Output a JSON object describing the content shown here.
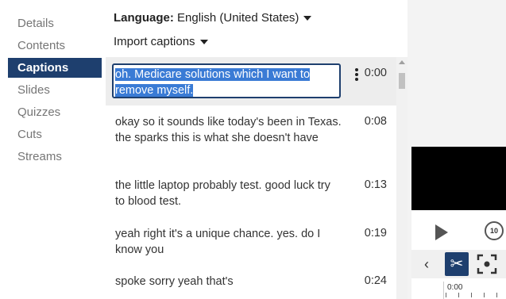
{
  "nav": {
    "items": [
      {
        "label": "Details",
        "active": false
      },
      {
        "label": "Contents",
        "active": false
      },
      {
        "label": "Captions",
        "active": true
      },
      {
        "label": "Slides",
        "active": false
      },
      {
        "label": "Quizzes",
        "active": false
      },
      {
        "label": "Cuts",
        "active": false
      },
      {
        "label": "Streams",
        "active": false
      }
    ]
  },
  "panel": {
    "language_label": "Language:",
    "language_value": "English (United States)",
    "import_label": "Import captions"
  },
  "captions": [
    {
      "text": "oh. Medicare solutions which I want to remove myself.",
      "time": "0:00",
      "selected": true
    },
    {
      "text": "okay so it sounds like today's been in Texas. the sparks this is what she doesn't have",
      "time": "0:08"
    },
    {
      "text": "the little laptop probably test. good luck try to blood test.",
      "time": "0:13"
    },
    {
      "text": "yeah right it's a unique chance. yes. do I know you",
      "time": "0:19"
    },
    {
      "text": "spoke sorry yeah that's",
      "time": "0:24"
    }
  ],
  "player": {
    "rewind_label": "10",
    "timeline_label": "0:00"
  },
  "colors": {
    "accent": "#1e3f6e",
    "selection": "#3a7bd5"
  }
}
